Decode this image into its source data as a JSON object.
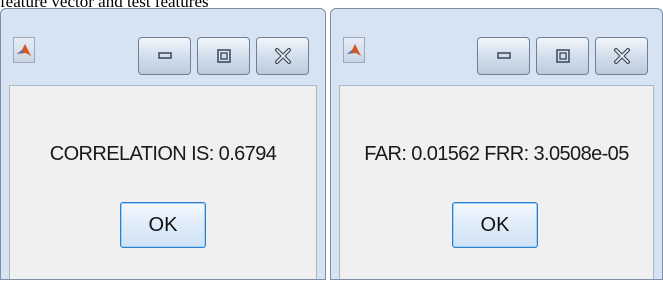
{
  "caption": "feature vector and test features",
  "dialogs": [
    {
      "message": "CORRELATION IS: 0.6794",
      "ok_label": "OK",
      "icons": {
        "app": "matlab-icon",
        "minimize": "minimize-icon",
        "maximize": "maximize-icon",
        "close": "close-icon"
      }
    },
    {
      "message": "FAR: 0.01562 FRR: 3.0508e-05",
      "ok_label": "OK",
      "icons": {
        "app": "matlab-icon",
        "minimize": "minimize-icon",
        "maximize": "maximize-icon",
        "close": "close-icon"
      }
    }
  ],
  "colors": {
    "titlebar": "#d6e3f2",
    "client": "#f0f0f0",
    "ok_border": "#2f7fcf"
  }
}
